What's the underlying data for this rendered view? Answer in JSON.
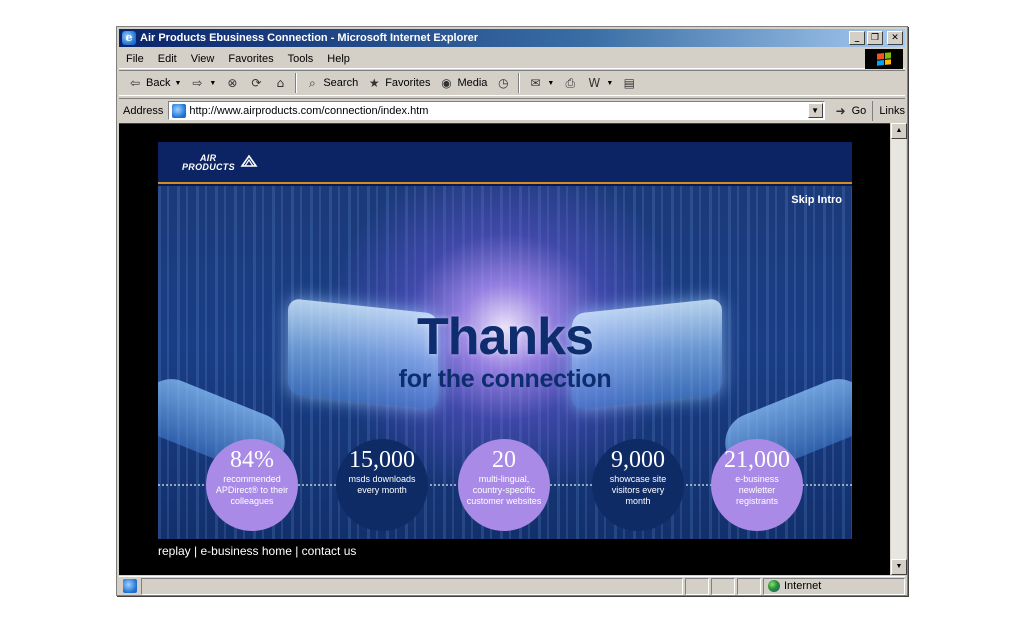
{
  "window": {
    "title": "Air Products Ebusiness Connection - Microsoft Internet Explorer",
    "controls": {
      "minimize": "_",
      "maximize": "❐",
      "close": "✕"
    }
  },
  "menu": [
    "File",
    "Edit",
    "View",
    "Favorites",
    "Tools",
    "Help"
  ],
  "toolbar": {
    "back": "Back",
    "search": "Search",
    "favorites": "Favorites",
    "media": "Media"
  },
  "address": {
    "label": "Address",
    "url": "http://www.airproducts.com/connection/index.htm",
    "go": "Go",
    "links": "Links"
  },
  "page": {
    "logo_line1": "AIR",
    "logo_line2": "PRODUCTS",
    "skip_intro": "Skip Intro",
    "headline": "Thanks",
    "subheadline": "for the connection",
    "stats": [
      {
        "number": "84%",
        "description": "recommended APDirect® to their colleagues",
        "style": "light"
      },
      {
        "number": "15,000",
        "description": "msds downloads every month",
        "style": "dark"
      },
      {
        "number": "20",
        "description": "multi-lingual, country-specific customer websites",
        "style": "light"
      },
      {
        "number": "9,000",
        "description": "showcase site visitors every month",
        "style": "dark"
      },
      {
        "number": "21,000",
        "description": "e-business newletter registrants",
        "style": "light"
      }
    ],
    "footer": {
      "replay": "replay",
      "separator": " | ",
      "ebusiness_home": "e-business home",
      "contact": "contact us"
    }
  },
  "status": {
    "zone": "Internet"
  },
  "colors": {
    "titlebar_start": "#0a246a",
    "banner_header": "#0c2463",
    "accent_line": "#d48b2a",
    "stat_light": "#a98ae6",
    "stat_dark": "#0e2b66",
    "headline": "#0d2d6e"
  }
}
